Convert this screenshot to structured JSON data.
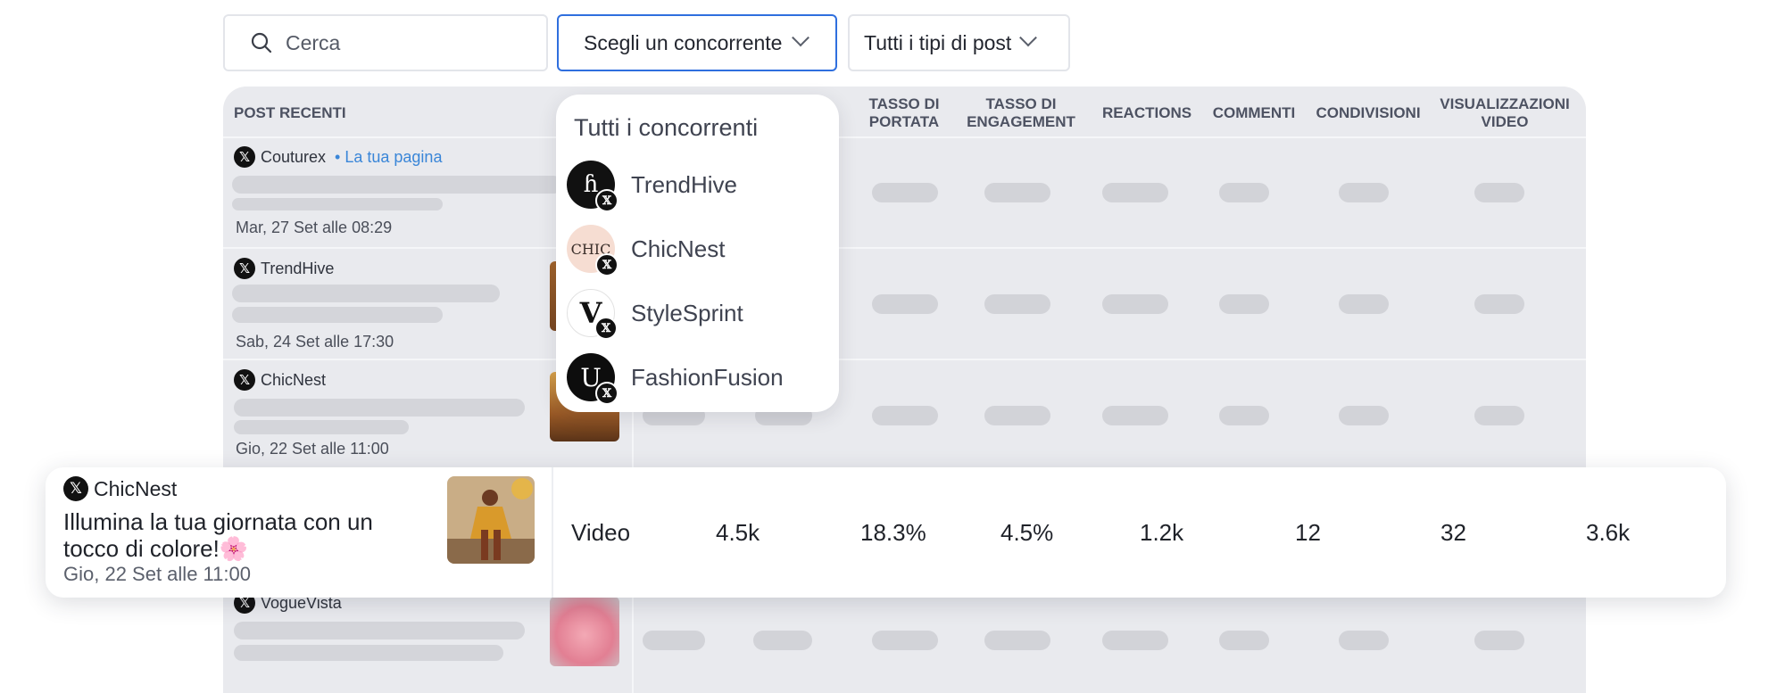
{
  "toolbar": {
    "search_placeholder": "Cerca",
    "competitor_select": "Scegli un concorrente",
    "post_type_select": "Tutti i tipi di post"
  },
  "table": {
    "headers": {
      "recent_posts": "POST RECENTI",
      "reach_rate": "TASSO DI PORTATA",
      "engagement_rate": "TASSO DI ENGAGEMENT",
      "reactions": "REACTIONS",
      "comments": "COMMENTI",
      "shares": "CONDIVISIONI",
      "video_views": "VISUALIZZAZIONI VIDEO"
    },
    "rows": [
      {
        "account": "Couturex",
        "badge": "• La tua pagina",
        "date": "Mar, 27 Set alle 08:29"
      },
      {
        "account": "TrendHive",
        "date": "Sab, 24 Set alle 17:30"
      },
      {
        "account": "ChicNest",
        "date": "Gio, 22 Set alle 11:00"
      },
      {
        "account": "VogueVista"
      }
    ]
  },
  "dropdown": {
    "title": "Tutti i concorrenti",
    "items": [
      {
        "name": "TrendHive",
        "icon": "trendhive-logo-icon"
      },
      {
        "name": "ChicNest",
        "icon": "chicnest-logo-icon"
      },
      {
        "name": "StyleSprint",
        "icon": "stylesprint-logo-icon"
      },
      {
        "name": "FashionFusion",
        "icon": "fashionfusion-logo-icon"
      }
    ]
  },
  "highlight": {
    "account": "ChicNest",
    "text": "Illumina la tua giornata con un tocco di colore!🌸",
    "date": "Gio, 22 Set alle 11:00",
    "type": "Video",
    "reach": "4.5k",
    "reach_rate": "18.3%",
    "engagement_rate": "4.5%",
    "reactions": "1.2k",
    "comments": "12",
    "shares": "32",
    "video_views": "3.6k"
  },
  "colors": {
    "accent_border": "#2f6fde",
    "own_page_link": "#3a86d8",
    "table_bg": "#e9eaee"
  }
}
